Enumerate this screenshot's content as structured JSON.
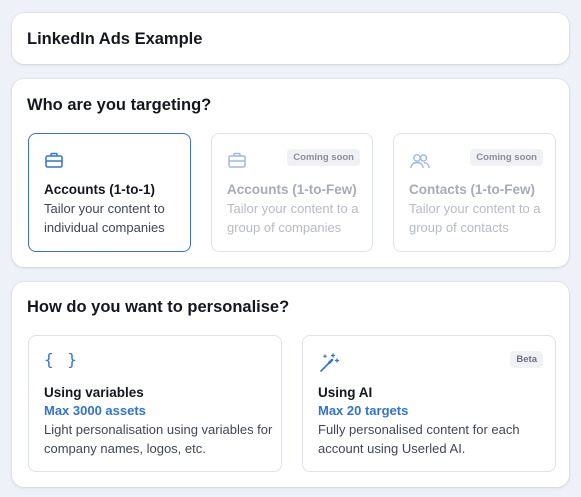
{
  "header": {
    "title": "LinkedIn Ads Example"
  },
  "targeting": {
    "heading": "Who are you targeting?",
    "options": [
      {
        "title": "Accounts (1-to-1)",
        "description": "Tailor your content to individual companies",
        "icon": "briefcase-icon",
        "selected": true,
        "badge": ""
      },
      {
        "title": "Accounts (1-to-Few)",
        "description": "Tailor your content to a group of companies",
        "icon": "briefcase-icon",
        "selected": false,
        "badge": "Coming soon"
      },
      {
        "title": "Contacts (1-to-Few)",
        "description": "Tailor your content to a group of contacts",
        "icon": "users-icon",
        "selected": false,
        "badge": "Coming soon"
      }
    ]
  },
  "personalise": {
    "heading": "How do you want to personalise?",
    "options": [
      {
        "title": "Using variables",
        "meta": "Max 3000 assets",
        "description": "Light personalisation using variables for company names, logos, etc.",
        "icon": "curly-braces-icon",
        "badge": ""
      },
      {
        "title": "Using AI",
        "meta": "Max 20 targets",
        "description": "Fully personalised content for each account using Userled AI.",
        "icon": "magic-wand-icon",
        "badge": "Beta"
      }
    ]
  },
  "colors": {
    "accent": "#2f74d6",
    "selected_border": "#3b6fd4",
    "background": "#eef1f7"
  }
}
